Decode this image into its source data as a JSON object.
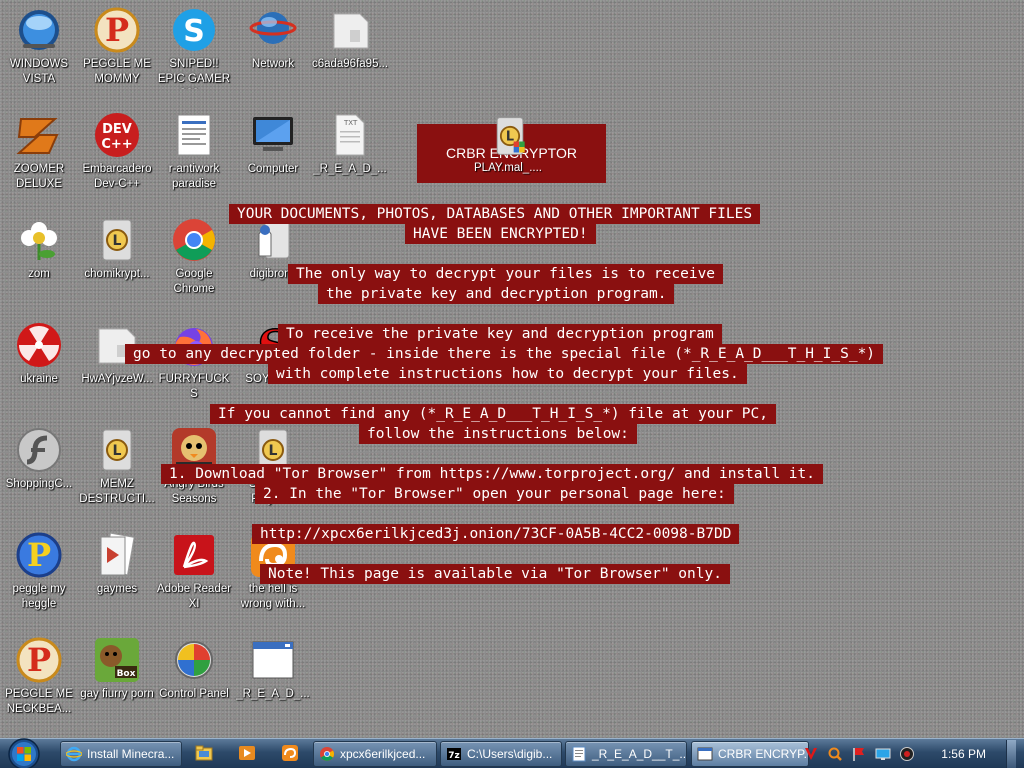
{
  "desktop": {
    "icons": [
      {
        "label": "WINDOWS VISTA",
        "icon": "vista-orb-icon"
      },
      {
        "label": "PEGGLE ME MOMMY",
        "icon": "peggle-icon"
      },
      {
        "label": "SNIPED!! EPIC GAMER 360...",
        "icon": "skype-icon"
      },
      {
        "label": "Network",
        "icon": "network-icon"
      },
      {
        "label": "c6ada96fa95...",
        "icon": "blank-file-icon"
      },
      {
        "label": "ZOOMER DELUXE",
        "icon": "zoomer-icon"
      },
      {
        "label": "Embarcadero Dev-C++",
        "icon": "devcpp-icon"
      },
      {
        "label": "r-antiwork paradise",
        "icon": "document-icon"
      },
      {
        "label": "Computer",
        "icon": "computer-icon"
      },
      {
        "label": "_R_E_A_D_...",
        "icon": "text-file-icon"
      },
      {
        "label": "zom",
        "icon": "flower-icon"
      },
      {
        "label": "chomikrypt...",
        "icon": "ransom-file-icon"
      },
      {
        "label": "Google Chrome",
        "icon": "chrome-icon"
      },
      {
        "label": "digibrony",
        "icon": "user-folder-icon"
      },
      {
        "label": "ukraine",
        "icon": "radiation-icon"
      },
      {
        "label": "HwAYjvzeW...",
        "icon": "blank-file-icon"
      },
      {
        "label": "FURRYFUCKS",
        "icon": "firefox-icon"
      },
      {
        "label": "SOYTOYS",
        "icon": "s-logo-icon"
      },
      {
        "label": "ShoppingC...",
        "icon": "flash-icon"
      },
      {
        "label": "MEMZ DESTRUCTI...",
        "icon": "ransom-file-icon"
      },
      {
        "label": "Angry Birds Seasons",
        "icon": "angry-birds-icon"
      },
      {
        "label": "Souptoys Playsets",
        "icon": "ransom-file-icon"
      },
      {
        "label": "peggle my heggle",
        "icon": "peggle-icon"
      },
      {
        "label": "gaymes",
        "icon": "media-folder-icon"
      },
      {
        "label": "Adobe Reader XI",
        "icon": "adobe-reader-icon"
      },
      {
        "label": "the hell is wrong with...",
        "icon": "uc-browser-icon"
      },
      {
        "label": "PEGGLE ME NECKBEA...",
        "icon": "peggle-icon"
      },
      {
        "label": "gay fiurry porn",
        "icon": "box-game-icon"
      },
      {
        "label": "Control Panel",
        "icon": "control-panel-icon"
      },
      {
        "label": "_R_E_A_D_...",
        "icon": "window-file-icon"
      }
    ]
  },
  "ransom_note": {
    "title": "CRBR ENCRYPTOR",
    "title_icon_label": "PLAY.mal_....",
    "lines": [
      "YOUR DOCUMENTS, PHOTOS, DATABASES AND OTHER IMPORTANT FILES",
      "HAVE BEEN ENCRYPTED!",
      "The only way to decrypt your files is to receive",
      "the private key and decryption program.",
      "To receive the private key and decryption program",
      "go to any decrypted folder - inside there is the special file (*_R_E_A_D___T_H_I_S_*)",
      "with complete instructions how to decrypt your files.",
      "If you cannot find any (*_R_E_A_D___T_H_I_S_*) file at your PC,",
      "follow the instructions below:",
      "1. Download \"Tor Browser\" from https://www.torproject.org/ and install it.",
      "2. In the \"Tor Browser\" open your personal page here:",
      "http://xpcx6erilkjced3j.onion/73CF-0A5B-4CC2-0098-B7DD",
      "Note! This page is available via \"Tor Browser\" only."
    ],
    "color": "#8a1010"
  },
  "taskbar": {
    "tasks": [
      {
        "label": "Install Minecra...",
        "icon": "ie-icon"
      },
      {
        "label": "xpcx6erilkjced...",
        "icon": "chrome-icon"
      },
      {
        "label": "C:\\Users\\digib...",
        "icon": "7zip-icon"
      },
      {
        "label": "_R_E_A_D__T_...",
        "icon": "notepad-icon"
      },
      {
        "label": "CRBR ENCRYP...",
        "icon": "window-icon"
      }
    ],
    "quick_launch": [
      "explorer-icon",
      "media-player-icon",
      "uc-browser-icon"
    ],
    "tray_icons": [
      "antivirus-v-icon",
      "search-tray-icon",
      "flag-icon",
      "monitor-icon",
      "volume-icon"
    ],
    "clock": "1:56 PM"
  }
}
